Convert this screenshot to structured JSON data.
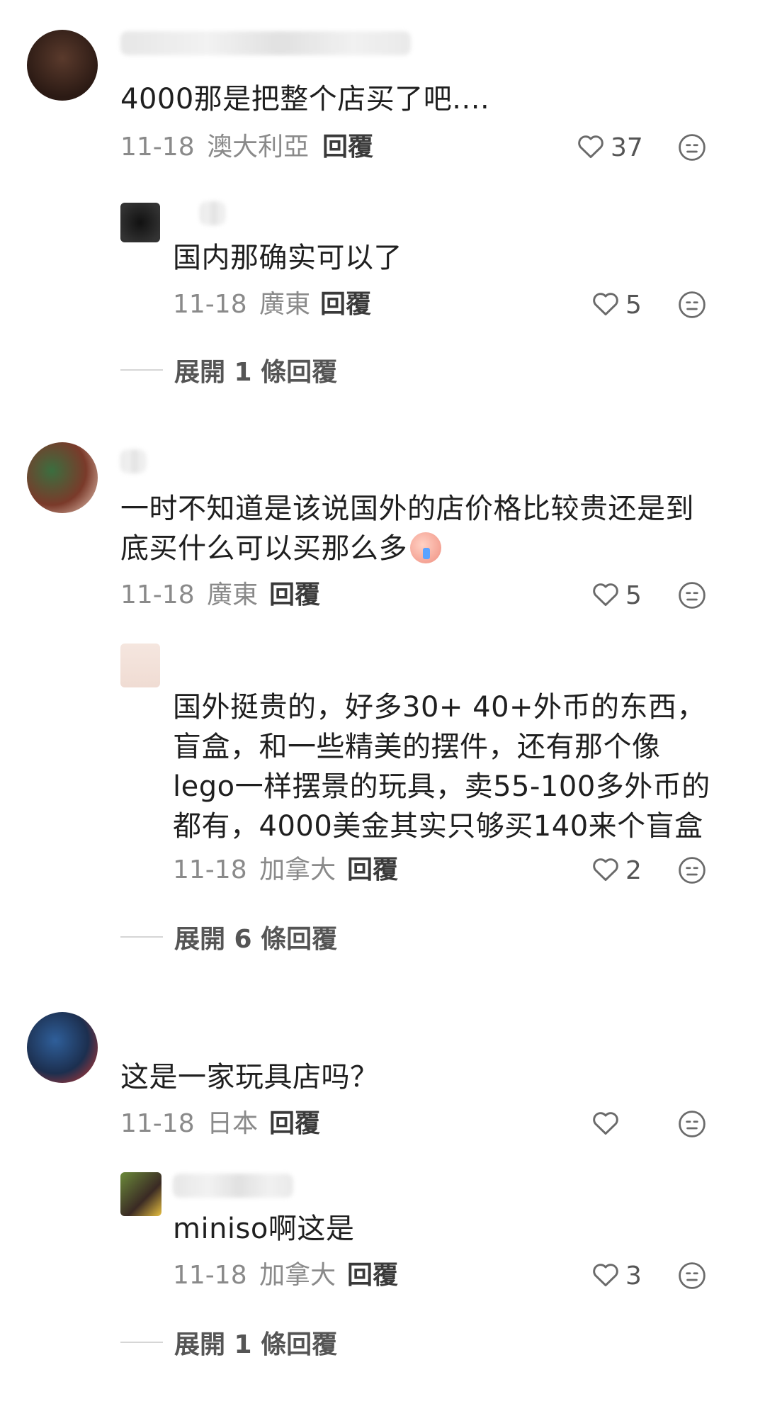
{
  "comments": [
    {
      "text": "4000那是把整个店买了吧....",
      "date": "11-18",
      "location": "澳大利亞",
      "reply_label": "回覆",
      "likes": "37",
      "replies": [
        {
          "text": "国内那确实可以了",
          "date": "11-18",
          "location": "廣東",
          "reply_label": "回覆",
          "likes": "5"
        }
      ],
      "expand_label": "展開 1 條回覆"
    },
    {
      "text": "一时不知道是该说国外的店价格比较贵还是到底买什么可以买那么多",
      "date": "11-18",
      "location": "廣東",
      "reply_label": "回覆",
      "likes": "5",
      "replies": [
        {
          "text": "国外挺贵的，好多30+ 40+外币的东西，盲盒，和一些精美的摆件，还有那个像lego一样摆景的玩具，卖55-100多外币的都有，4000美金其实只够买140来个盲盒",
          "date": "11-18",
          "location": "加拿大",
          "reply_label": "回覆",
          "likes": "2"
        }
      ],
      "expand_label": "展開 6 條回覆"
    },
    {
      "text": "这是一家玩具店吗？",
      "date": "11-18",
      "location": "日本",
      "reply_label": "回覆",
      "likes": "",
      "replies": [
        {
          "text": "miniso啊这是",
          "date": "11-18",
          "location": "加拿大",
          "reply_label": "回覆",
          "likes": "3"
        }
      ],
      "expand_label": "展開 1 條回覆"
    }
  ],
  "icons": {
    "like": "heart-outline-icon",
    "reaction": "neutral-face-icon",
    "inline_emoji": "crying-face-emoji"
  },
  "colors": {
    "text": "#1f1f1f",
    "meta": "#8a8a8a",
    "divider": "#d6d6d6"
  }
}
